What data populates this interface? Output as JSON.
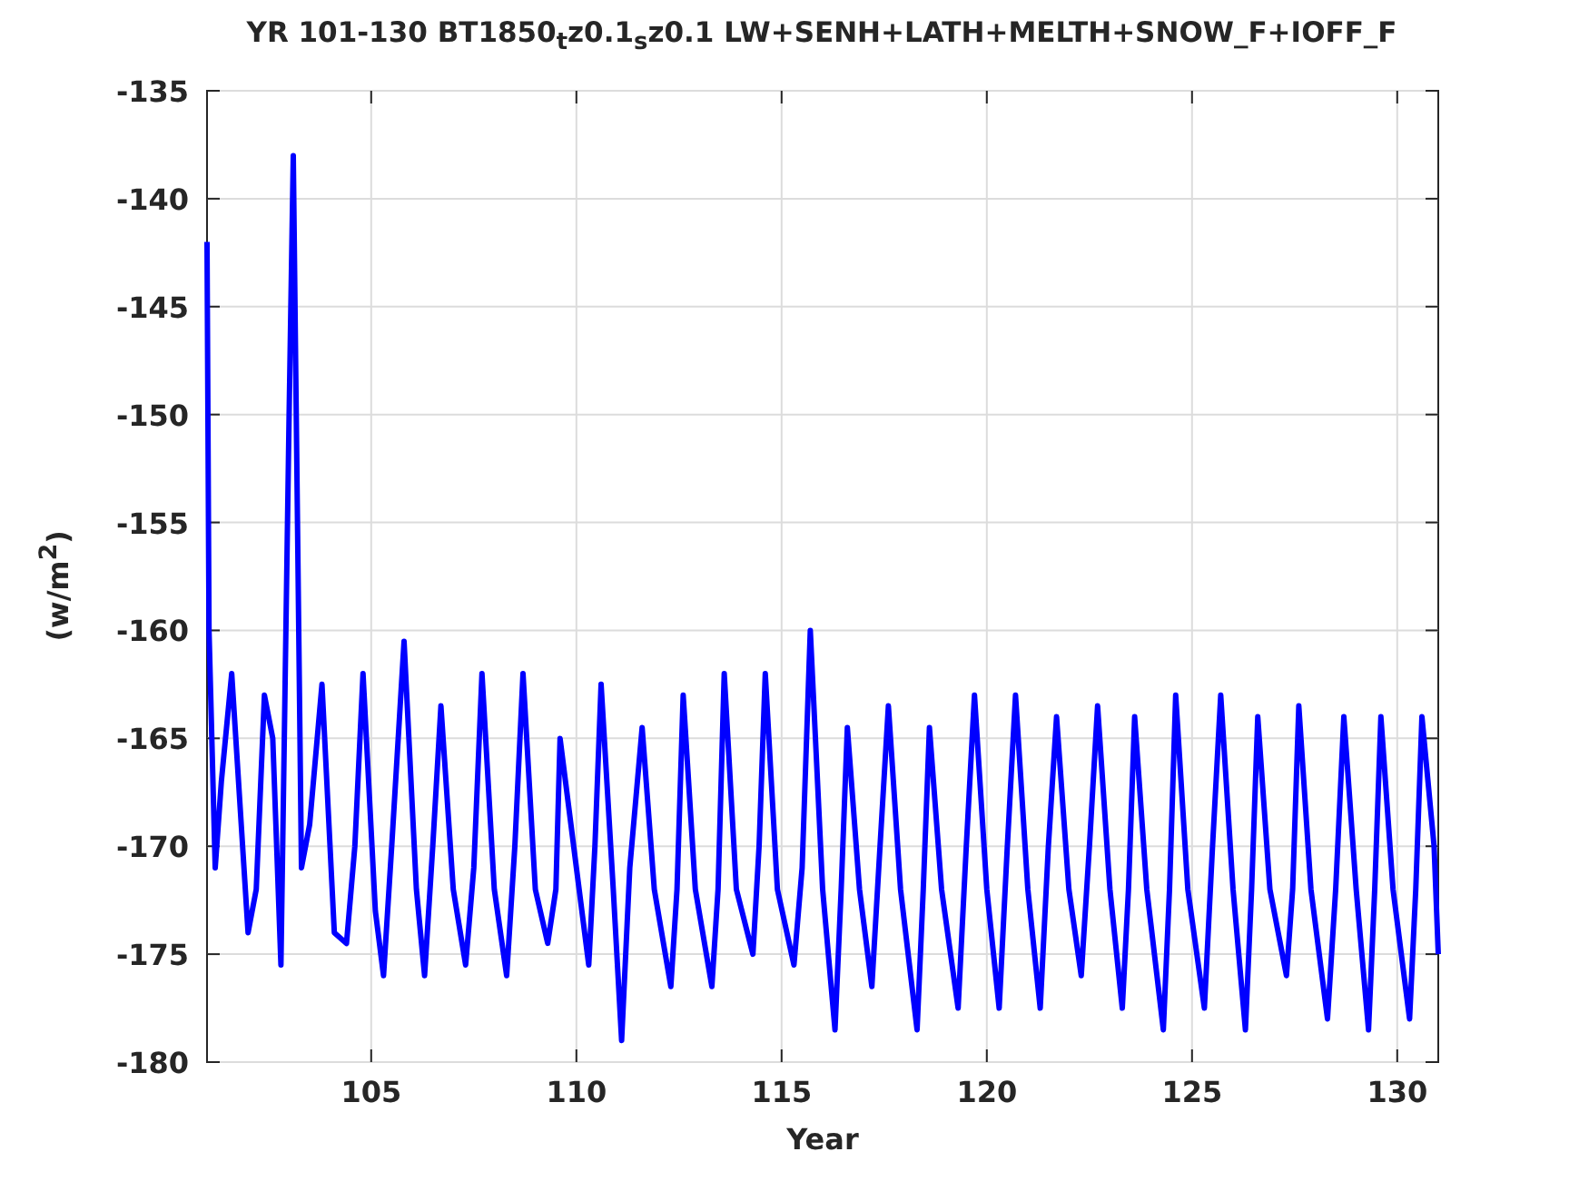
{
  "figure": {
    "chart_data": {
      "type": "line",
      "title": "YR 101-130 BT1850$_{t}$z0.1$_{s}$z0.1 LW+SENH+LATH+MELTH+SNOW_F+IOFF_F",
      "xlabel": "Year",
      "ylabel": "(w/m$^{2}$)",
      "xlim": [
        101,
        131
      ],
      "ylim": [
        -180,
        -135
      ],
      "xticks": [
        105,
        110,
        115,
        120,
        125,
        130
      ],
      "yticks": [
        -180,
        -175,
        -170,
        -165,
        -160,
        -155,
        -150,
        -145,
        -140,
        -135
      ],
      "x": [
        101.0,
        101.05,
        101.2,
        101.35,
        101.6,
        102.0,
        102.2,
        102.4,
        102.6,
        102.8,
        103.0,
        103.1,
        103.3,
        103.5,
        103.8,
        104.1,
        104.4,
        104.6,
        104.8,
        105.1,
        105.3,
        105.5,
        105.8,
        106.1,
        106.3,
        106.5,
        106.7,
        107.0,
        107.3,
        107.5,
        107.7,
        108.0,
        108.3,
        108.5,
        108.7,
        109.0,
        109.3,
        109.5,
        109.6,
        110.0,
        110.3,
        110.45,
        110.6,
        110.9,
        111.1,
        111.3,
        111.6,
        111.9,
        112.3,
        112.45,
        112.6,
        112.9,
        113.3,
        113.45,
        113.6,
        113.9,
        114.3,
        114.45,
        114.6,
        114.9,
        115.3,
        115.5,
        115.7,
        116.0,
        116.3,
        116.45,
        116.6,
        116.9,
        117.2,
        117.4,
        117.6,
        117.9,
        118.3,
        118.45,
        118.6,
        118.9,
        119.3,
        119.5,
        119.7,
        120.0,
        120.3,
        120.5,
        120.7,
        121.0,
        121.3,
        121.5,
        121.7,
        122.0,
        122.3,
        122.5,
        122.7,
        123.0,
        123.3,
        123.45,
        123.6,
        123.9,
        124.3,
        124.45,
        124.6,
        124.9,
        125.3,
        125.5,
        125.7,
        126.0,
        126.3,
        126.45,
        126.6,
        126.9,
        127.3,
        127.45,
        127.6,
        127.9,
        128.3,
        128.5,
        128.7,
        129.0,
        129.3,
        129.45,
        129.6,
        129.9,
        130.3,
        130.45,
        130.6,
        130.9,
        131.0
      ],
      "grid": true,
      "series": [
        {
          "color": "#0000ff",
          "values": [
            -142,
            -160,
            -171,
            -167,
            -162,
            -174,
            -172,
            -163,
            -165,
            -175.5,
            -150,
            -138,
            -171,
            -169,
            -162.5,
            -174,
            -174.5,
            -170,
            -162,
            -173,
            -176,
            -170,
            -160.5,
            -172,
            -176,
            -170,
            -163.5,
            -172,
            -175.5,
            -171,
            -162,
            -172,
            -176,
            -170,
            -162,
            -172,
            -174.5,
            -172,
            -165,
            -171,
            -175.5,
            -170,
            -162.5,
            -172,
            -179,
            -171,
            -164.5,
            -172,
            -176.5,
            -172,
            -163,
            -172,
            -176.5,
            -172,
            -162,
            -172,
            -175,
            -170,
            -162,
            -172,
            -175.5,
            -171,
            -160,
            -172,
            -178.5,
            -172,
            -164.5,
            -172,
            -176.5,
            -170,
            -163.5,
            -172,
            -178.5,
            -172,
            -164.5,
            -172,
            -177.5,
            -170,
            -163,
            -172,
            -177.5,
            -170,
            -163,
            -172,
            -177.5,
            -170,
            -164,
            -172,
            -176,
            -170,
            -163.5,
            -172,
            -177.5,
            -172,
            -164,
            -172,
            -178.5,
            -172,
            -163,
            -172,
            -177.5,
            -170,
            -163,
            -172,
            -178.5,
            -172,
            -164,
            -172,
            -176,
            -172,
            -163.5,
            -172,
            -178,
            -172,
            -164,
            -172,
            -178.5,
            -172,
            -164,
            -172,
            -178,
            -172,
            -164,
            -170,
            -175
          ]
        }
      ]
    }
  }
}
